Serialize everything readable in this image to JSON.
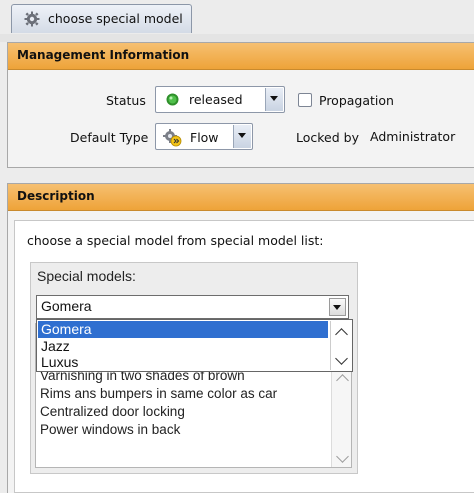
{
  "tab": {
    "label": "choose special model",
    "icon": "gear-icon"
  },
  "management": {
    "header": "Management Information",
    "status_label": "Status",
    "status_value": "released",
    "status_icon_color": "#3fae3a",
    "propagation_label": "Propagation",
    "propagation_checked": false,
    "default_type_label": "Default Type",
    "default_type_value": "Flow",
    "locked_by_label": "Locked by",
    "locked_by_value": "Administrator"
  },
  "description": {
    "header": "Description",
    "prompt": "choose a special model from special model list:",
    "special_models_label": "Special models:",
    "selected_model": "Gomera",
    "dropdown_options": [
      "Gomera",
      "Jazz",
      "Luxus"
    ],
    "feature_list": [
      "Varnishing in two shades of brown",
      "Rims ans bumpers in same color as car",
      "Centralized door locking",
      "Power windows in back"
    ]
  },
  "colors": {
    "header_orange": "#eea339",
    "selection_blue": "#2f6fd0"
  }
}
